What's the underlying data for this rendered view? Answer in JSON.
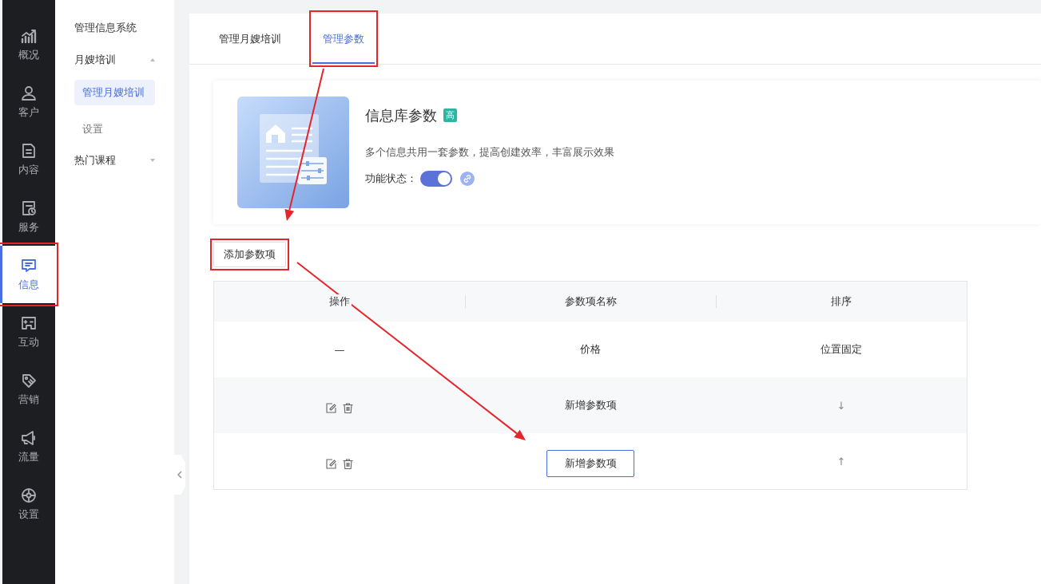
{
  "nav": [
    {
      "kind": "chart",
      "label": "概况",
      "selected": false,
      "highlighted": false
    },
    {
      "kind": "user",
      "label": "客户",
      "selected": false,
      "highlighted": false
    },
    {
      "kind": "doc",
      "label": "内容",
      "selected": false,
      "highlighted": false
    },
    {
      "kind": "service",
      "label": "服务",
      "selected": false,
      "highlighted": false
    },
    {
      "kind": "message",
      "label": "信息",
      "selected": true,
      "highlighted": true
    },
    {
      "kind": "game",
      "label": "互动",
      "selected": false,
      "highlighted": false
    },
    {
      "kind": "tag",
      "label": "营销",
      "selected": false,
      "highlighted": false
    },
    {
      "kind": "megaphone",
      "label": "流量",
      "selected": false,
      "highlighted": false
    },
    {
      "kind": "gear",
      "label": "设置",
      "selected": false,
      "highlighted": false
    }
  ],
  "subnav": {
    "title": "管理信息系统",
    "groups": [
      {
        "label": "月嫂培训",
        "expanded": true,
        "children": [
          {
            "label": "管理月嫂培训",
            "selected": true
          },
          {
            "label": "设置",
            "selected": false
          }
        ]
      },
      {
        "label": "热门课程",
        "expanded": false
      }
    ]
  },
  "tabs": [
    {
      "label": "管理月嫂培训",
      "selected": false,
      "highlighted": false
    },
    {
      "label": "管理参数",
      "selected": true,
      "highlighted": true
    }
  ],
  "card": {
    "title": "信息库参数",
    "badge": "高",
    "description": "多个信息共用一套参数，提高创建效率，丰富展示效果",
    "status_label": "功能状态：",
    "status_on": true
  },
  "add_button": {
    "label": "添加参数项",
    "highlighted": true
  },
  "table": {
    "columns": [
      "操作",
      "参数项名称",
      "排序"
    ],
    "rows": [
      {
        "kind": "fixed",
        "operation": "—",
        "name": "价格",
        "editing": false,
        "sort": "位置固定"
      },
      {
        "kind": "editable",
        "name": "新增参数项",
        "editing": false,
        "sort": "↓"
      },
      {
        "kind": "editable",
        "name": "新增参数项",
        "editing": true,
        "sort": "↑"
      }
    ]
  }
}
